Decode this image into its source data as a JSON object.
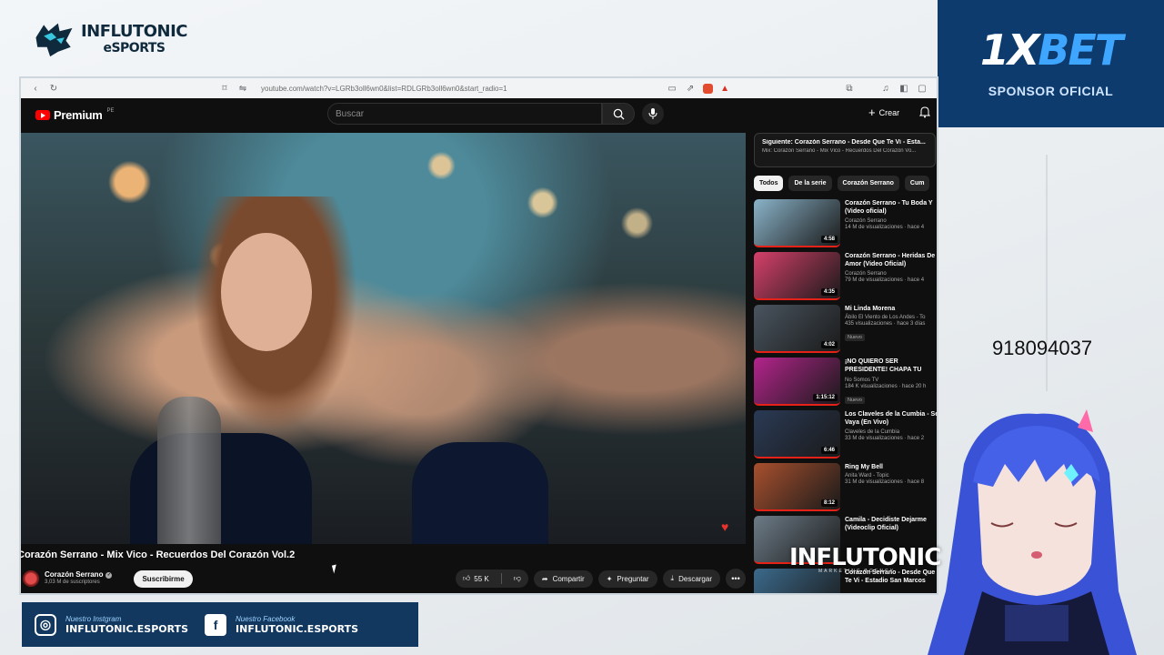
{
  "overlay": {
    "brand_line1": "INFLUTONIC",
    "brand_line2": "eSPORTS",
    "sponsor_logo_a": "1X",
    "sponsor_logo_b": "BET",
    "sponsor_label": "SPONSOR OFICIAL",
    "phone": "918094037",
    "social": [
      {
        "label": "Nuestro Instgram",
        "handle": "INFLUTONIC.ESPORTS",
        "icon": "instagram-icon"
      },
      {
        "label": "Nuestro Facebook",
        "handle": "INFLUTONIC.ESPORTS",
        "icon": "facebook-icon"
      }
    ],
    "watermark": "INFLUTONIC",
    "watermark_sub": "MARKETING AGENCY"
  },
  "browser": {
    "url": "youtube.com/watch?v=LGRb3oll6wn0&list=RDLGRb3oll6wn0&start_radio=1"
  },
  "youtube": {
    "logo": "Premium",
    "region": "PE",
    "search_placeholder": "Buscar",
    "create_label": "Crear",
    "video": {
      "title": "Corazón Serrano - Mix Vico - Recuerdos Del Corazón Vol.2",
      "channel": "Corazón Serrano",
      "subscribers": "3,03 M de suscriptores",
      "subscribe_label": "Suscribirme",
      "likes": "55 K",
      "share_label": "Compartir",
      "ask_label": "Preguntar",
      "download_label": "Descargar"
    },
    "next": {
      "title": "Siguiente: Corazón Serrano - Desde Que Te Vi - Esta...",
      "sub": "Mix: Corazón Serrano - Mix Vico - Recuerdos Del Corazón Vo..."
    },
    "chips": [
      "Todos",
      "De la serie",
      "Corazón Serrano",
      "Cum"
    ],
    "recommendations": [
      {
        "title": "Corazón Serrano - Tu Boda Y (Video oficial)",
        "channel": "Corazón Serrano",
        "verified": true,
        "meta": "14 M de visualizaciones · hace 4",
        "duration": "4:58",
        "new": false,
        "color": "#8ab3c9"
      },
      {
        "title": "Corazón Serrano - Heridas De Amor (Video Oficial)",
        "channel": "Corazón Serrano",
        "verified": true,
        "meta": "79 M de visualizaciones · hace 4",
        "duration": "4:35",
        "new": false,
        "color": "#d6406a"
      },
      {
        "title": "Mi Linda Morena",
        "channel": "Ábilo El Viento de Los Andes - To",
        "verified": false,
        "meta": "435 visualizaciones · hace 3 días",
        "duration": "4:02",
        "new": true,
        "color": "#4a5560"
      },
      {
        "title": "¡NO QUIERO SER PRESIDENTE! CHAPA TU MONEY",
        "channel": "No Somos TV",
        "verified": true,
        "meta": "184 K visualizaciones · hace 20 h",
        "duration": "1:15:12",
        "new": true,
        "color": "#b4248c"
      },
      {
        "title": "Los Claveles de la Cumbia - Se Vaya (En Vivo)",
        "channel": "Claveles de la Cumbia",
        "verified": true,
        "meta": "33 M de visualizaciones · hace 2",
        "duration": "6:46",
        "new": false,
        "color": "#2a3a55"
      },
      {
        "title": "Ring My Bell",
        "channel": "Anita Ward - Topic",
        "verified": false,
        "meta": "31 M de visualizaciones · hace 8",
        "duration": "8:12",
        "new": false,
        "color": "#a8502e"
      },
      {
        "title": "Camila - Decidiste Dejarme (Videoclip Oficial)",
        "channel": "",
        "verified": false,
        "meta": "",
        "duration": "",
        "new": false,
        "color": "#6d7c88"
      },
      {
        "title": "Corazón Serrano - Desde Que Te Vi - Estadio San Marcos",
        "channel": "",
        "verified": false,
        "meta": "",
        "duration": "",
        "new": false,
        "color": "#3b6a8c"
      }
    ]
  }
}
